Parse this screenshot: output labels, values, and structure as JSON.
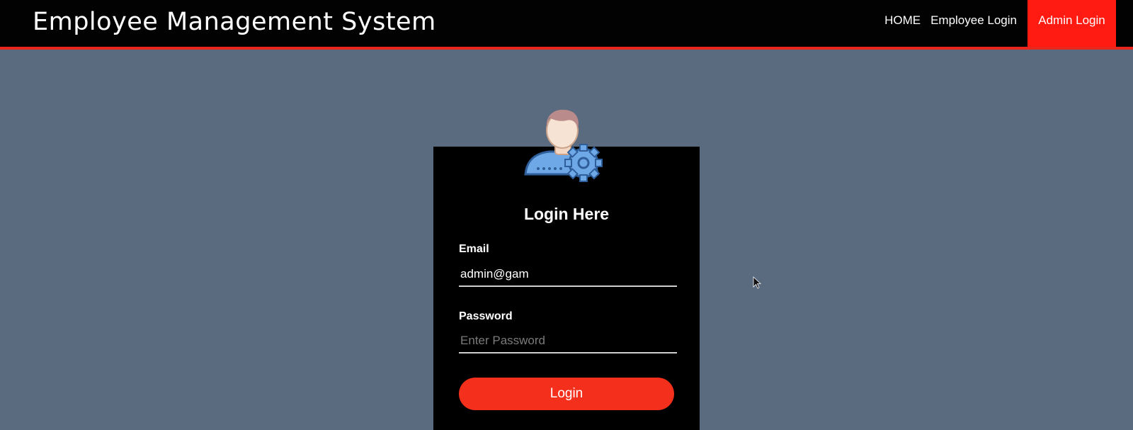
{
  "app": {
    "title": "Employee Management System"
  },
  "nav": {
    "items": [
      {
        "label": "HOME",
        "active": false
      },
      {
        "label": "Employee Login",
        "active": false
      },
      {
        "label": "Admin Login",
        "active": true
      }
    ]
  },
  "login": {
    "avatar_icon": "admin-user-gear-icon",
    "title": "Login Here",
    "email_label": "Email",
    "email_value": "admin@gam",
    "email_placeholder": "",
    "password_label": "Password",
    "password_value": "",
    "password_placeholder": "Enter Password",
    "button_label": "Login"
  },
  "colors": {
    "background": "#5a6b80",
    "navbar": "#020202",
    "accent": "#ff1a12",
    "button": "#f42f1c",
    "card": "#000000"
  }
}
